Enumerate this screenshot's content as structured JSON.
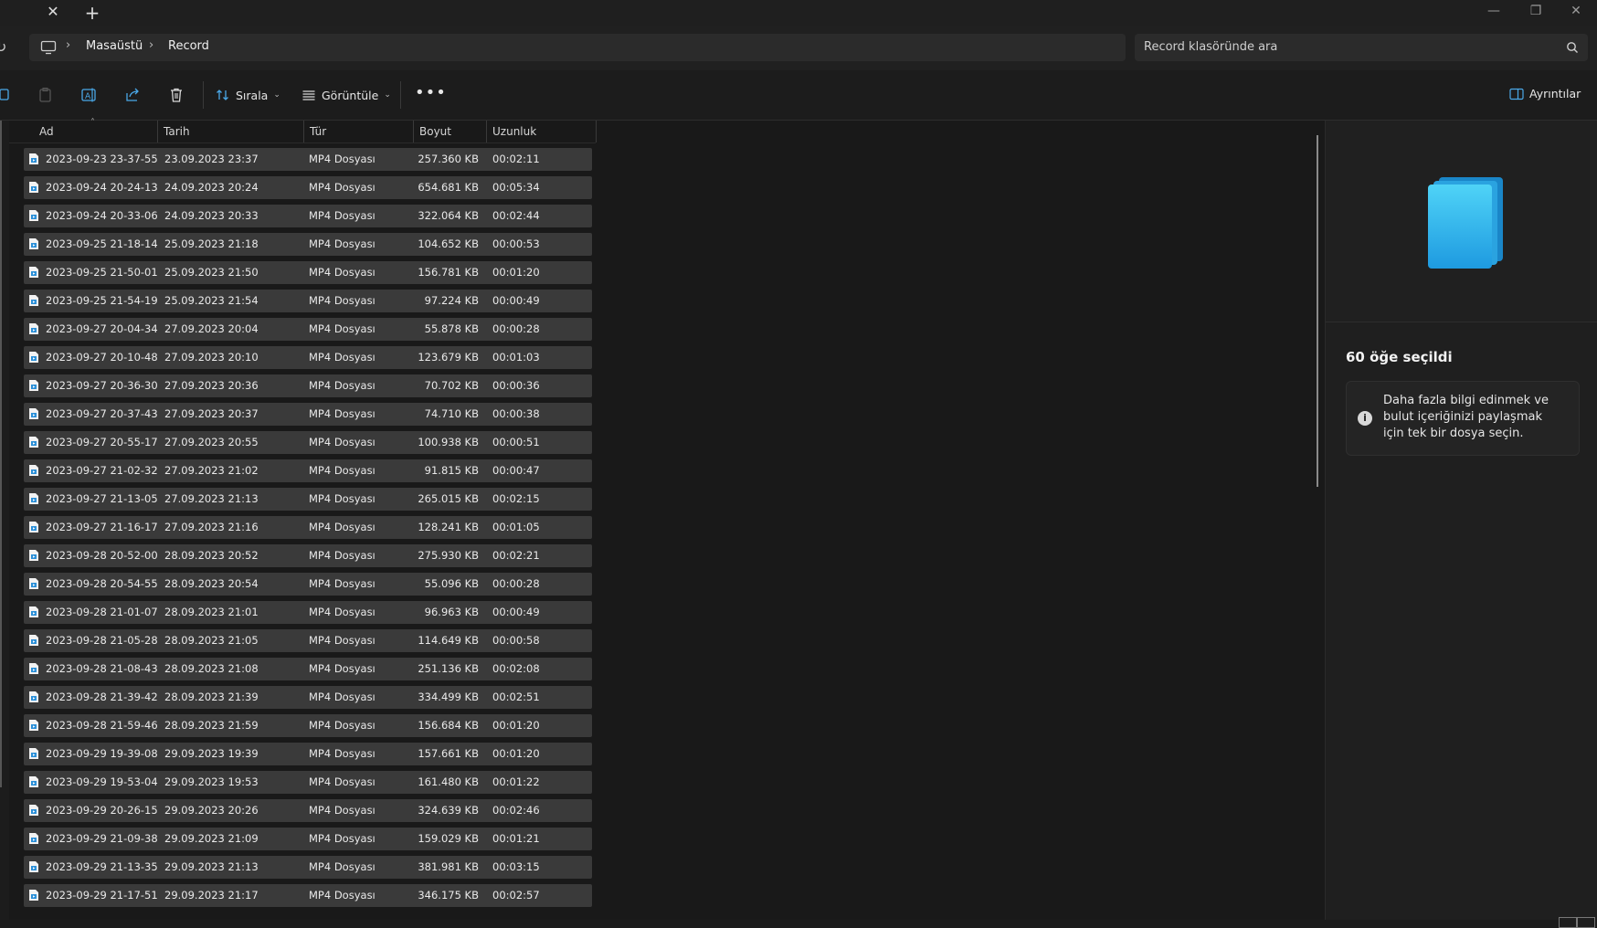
{
  "window": {
    "new_tab": "+",
    "close_tab": "✕",
    "minimize": "—",
    "maximize": "❐",
    "close": "✕"
  },
  "breadcrumb": {
    "items": [
      "Masaüstü",
      "Record"
    ],
    "separator": "›"
  },
  "search": {
    "placeholder": "Record klasöründe ara"
  },
  "toolbar": {
    "sort_label": "Sırala",
    "view_label": "Görüntüle",
    "more": "•••",
    "details_label": "Ayrıntılar"
  },
  "columns": {
    "name": "Ad",
    "date": "Tarih",
    "type": "Tür",
    "size": "Boyut",
    "length": "Uzunluk"
  },
  "rows": [
    {
      "name": "2023-09-23 23-37-55",
      "date": "23.09.2023 23:37",
      "type": "MP4 Dosyası",
      "size": "257.360 KB",
      "length": "00:02:11"
    },
    {
      "name": "2023-09-24 20-24-13",
      "date": "24.09.2023 20:24",
      "type": "MP4 Dosyası",
      "size": "654.681 KB",
      "length": "00:05:34"
    },
    {
      "name": "2023-09-24 20-33-06",
      "date": "24.09.2023 20:33",
      "type": "MP4 Dosyası",
      "size": "322.064 KB",
      "length": "00:02:44"
    },
    {
      "name": "2023-09-25 21-18-14",
      "date": "25.09.2023 21:18",
      "type": "MP4 Dosyası",
      "size": "104.652 KB",
      "length": "00:00:53"
    },
    {
      "name": "2023-09-25 21-50-01",
      "date": "25.09.2023 21:50",
      "type": "MP4 Dosyası",
      "size": "156.781 KB",
      "length": "00:01:20"
    },
    {
      "name": "2023-09-25 21-54-19",
      "date": "25.09.2023 21:54",
      "type": "MP4 Dosyası",
      "size": "97.224 KB",
      "length": "00:00:49"
    },
    {
      "name": "2023-09-27 20-04-34",
      "date": "27.09.2023 20:04",
      "type": "MP4 Dosyası",
      "size": "55.878 KB",
      "length": "00:00:28"
    },
    {
      "name": "2023-09-27 20-10-48",
      "date": "27.09.2023 20:10",
      "type": "MP4 Dosyası",
      "size": "123.679 KB",
      "length": "00:01:03"
    },
    {
      "name": "2023-09-27 20-36-30",
      "date": "27.09.2023 20:36",
      "type": "MP4 Dosyası",
      "size": "70.702 KB",
      "length": "00:00:36"
    },
    {
      "name": "2023-09-27 20-37-43",
      "date": "27.09.2023 20:37",
      "type": "MP4 Dosyası",
      "size": "74.710 KB",
      "length": "00:00:38"
    },
    {
      "name": "2023-09-27 20-55-17",
      "date": "27.09.2023 20:55",
      "type": "MP4 Dosyası",
      "size": "100.938 KB",
      "length": "00:00:51"
    },
    {
      "name": "2023-09-27 21-02-32",
      "date": "27.09.2023 21:02",
      "type": "MP4 Dosyası",
      "size": "91.815 KB",
      "length": "00:00:47"
    },
    {
      "name": "2023-09-27 21-13-05",
      "date": "27.09.2023 21:13",
      "type": "MP4 Dosyası",
      "size": "265.015 KB",
      "length": "00:02:15"
    },
    {
      "name": "2023-09-27 21-16-17",
      "date": "27.09.2023 21:16",
      "type": "MP4 Dosyası",
      "size": "128.241 KB",
      "length": "00:01:05"
    },
    {
      "name": "2023-09-28 20-52-00",
      "date": "28.09.2023 20:52",
      "type": "MP4 Dosyası",
      "size": "275.930 KB",
      "length": "00:02:21"
    },
    {
      "name": "2023-09-28 20-54-55",
      "date": "28.09.2023 20:54",
      "type": "MP4 Dosyası",
      "size": "55.096 KB",
      "length": "00:00:28"
    },
    {
      "name": "2023-09-28 21-01-07",
      "date": "28.09.2023 21:01",
      "type": "MP4 Dosyası",
      "size": "96.963 KB",
      "length": "00:00:49"
    },
    {
      "name": "2023-09-28 21-05-28",
      "date": "28.09.2023 21:05",
      "type": "MP4 Dosyası",
      "size": "114.649 KB",
      "length": "00:00:58"
    },
    {
      "name": "2023-09-28 21-08-43",
      "date": "28.09.2023 21:08",
      "type": "MP4 Dosyası",
      "size": "251.136 KB",
      "length": "00:02:08"
    },
    {
      "name": "2023-09-28 21-39-42",
      "date": "28.09.2023 21:39",
      "type": "MP4 Dosyası",
      "size": "334.499 KB",
      "length": "00:02:51"
    },
    {
      "name": "2023-09-28 21-59-46",
      "date": "28.09.2023 21:59",
      "type": "MP4 Dosyası",
      "size": "156.684 KB",
      "length": "00:01:20"
    },
    {
      "name": "2023-09-29 19-39-08",
      "date": "29.09.2023 19:39",
      "type": "MP4 Dosyası",
      "size": "157.661 KB",
      "length": "00:01:20"
    },
    {
      "name": "2023-09-29 19-53-04",
      "date": "29.09.2023 19:53",
      "type": "MP4 Dosyası",
      "size": "161.480 KB",
      "length": "00:01:22"
    },
    {
      "name": "2023-09-29 20-26-15",
      "date": "29.09.2023 20:26",
      "type": "MP4 Dosyası",
      "size": "324.639 KB",
      "length": "00:02:46"
    },
    {
      "name": "2023-09-29 21-09-38",
      "date": "29.09.2023 21:09",
      "type": "MP4 Dosyası",
      "size": "159.029 KB",
      "length": "00:01:21"
    },
    {
      "name": "2023-09-29 21-13-35",
      "date": "29.09.2023 21:13",
      "type": "MP4 Dosyası",
      "size": "381.981 KB",
      "length": "00:03:15"
    },
    {
      "name": "2023-09-29 21-17-51",
      "date": "29.09.2023 21:17",
      "type": "MP4 Dosyası",
      "size": "346.175 KB",
      "length": "00:02:57"
    }
  ],
  "details": {
    "selected_count": "60 öğe seçildi",
    "info_text": "Daha fazla bilgi edinmek ve bulut içeriğinizi paylaşmak için tek bir dosya seçin.",
    "info_icon": "i"
  },
  "colors": {
    "accent": "#3ab4f2",
    "row_bg": "#3a3a3a",
    "window_bg": "#1c1c1c"
  }
}
